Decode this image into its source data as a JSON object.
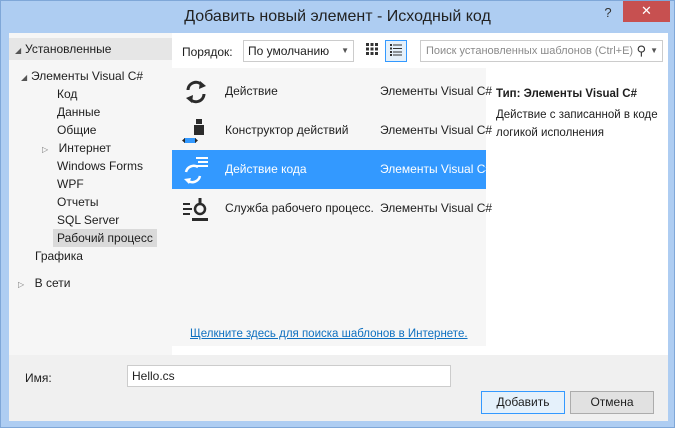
{
  "window": {
    "title": "Добавить новый элемент - Исходный код",
    "help": "?",
    "close": "✕"
  },
  "tree": {
    "header": "Установленные",
    "root": "Элементы Visual C#",
    "children": [
      "Код",
      "Данные",
      "Общие",
      "Интернет",
      "Windows Forms",
      "WPF",
      "Отчеты",
      "SQL Server",
      "Рабочий процесс"
    ],
    "graphics": "Графика",
    "online": "В сети"
  },
  "toolbar": {
    "sort_label": "Порядок:",
    "sort_value": "По умолчанию",
    "search_placeholder": "Поиск установленных шаблонов (Ctrl+E)"
  },
  "templates": [
    {
      "name": "Действие",
      "type": "Элементы Visual C#",
      "icon": "activity-icon"
    },
    {
      "name": "Конструктор действий",
      "type": "Элементы Visual C#",
      "icon": "activity-designer-icon"
    },
    {
      "name": "Действие кода",
      "type": "Элементы Visual C#",
      "icon": "code-activity-icon"
    },
    {
      "name": "Служба рабочего процесс...",
      "type": "Элементы Visual C#",
      "icon": "workflow-service-icon"
    }
  ],
  "online_link": "Щелкните здесь для поиска шаблонов в Интернете.",
  "details": {
    "type_line": "Тип: Элементы Visual C#",
    "description": "Действие с записанной в коде логикой исполнения"
  },
  "bottom": {
    "name_label": "Имя:",
    "name_value": "Hello.cs",
    "add_label": "Добавить",
    "cancel_label": "Отмена"
  },
  "colors": {
    "selection": "#3399ff",
    "link": "#0e70c0",
    "close_button": "#c75050",
    "frame": "#aecdf2"
  }
}
